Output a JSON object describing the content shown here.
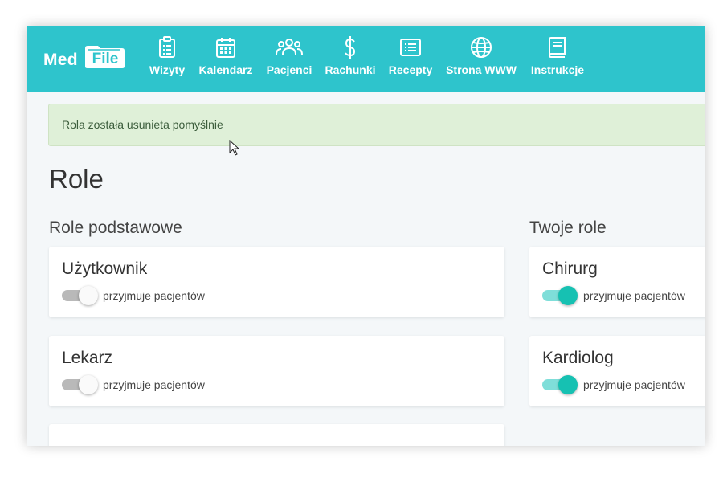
{
  "brand": {
    "logo_med": "Med",
    "logo_file": "File"
  },
  "nav": [
    {
      "label": "Wizyty",
      "icon": "clipboard-icon"
    },
    {
      "label": "Kalendarz",
      "icon": "calendar-icon"
    },
    {
      "label": "Pacjenci",
      "icon": "users-icon"
    },
    {
      "label": "Rachunki",
      "icon": "dollar-icon"
    },
    {
      "label": "Recepty",
      "icon": "list-icon"
    },
    {
      "label": "Strona WWW",
      "icon": "globe-icon"
    },
    {
      "label": "Instrukcje",
      "icon": "book-icon"
    }
  ],
  "alert": {
    "message": "Rola została usunieta pomyślnie"
  },
  "page": {
    "title": "Role"
  },
  "sections": {
    "basic": {
      "title": "Role podstawowe",
      "roles": [
        {
          "name": "Użytkownik",
          "toggle_label": "przyjmuje pacjentów",
          "accepts_patients": false
        },
        {
          "name": "Lekarz",
          "toggle_label": "przyjmuje pacjentów",
          "accepts_patients": false
        }
      ]
    },
    "custom": {
      "title": "Twoje role",
      "roles": [
        {
          "name": "Chirurg",
          "toggle_label": "przyjmuje pacjentów",
          "accepts_patients": true
        },
        {
          "name": "Kardiolog",
          "toggle_label": "przyjmuje pacjentów",
          "accepts_patients": true
        }
      ]
    }
  },
  "colors": {
    "navbar": "#2ec4cc",
    "toggle_on": "#16c1b2",
    "toggle_off": "#b9b9b9",
    "alert_bg": "#dff0d8"
  }
}
